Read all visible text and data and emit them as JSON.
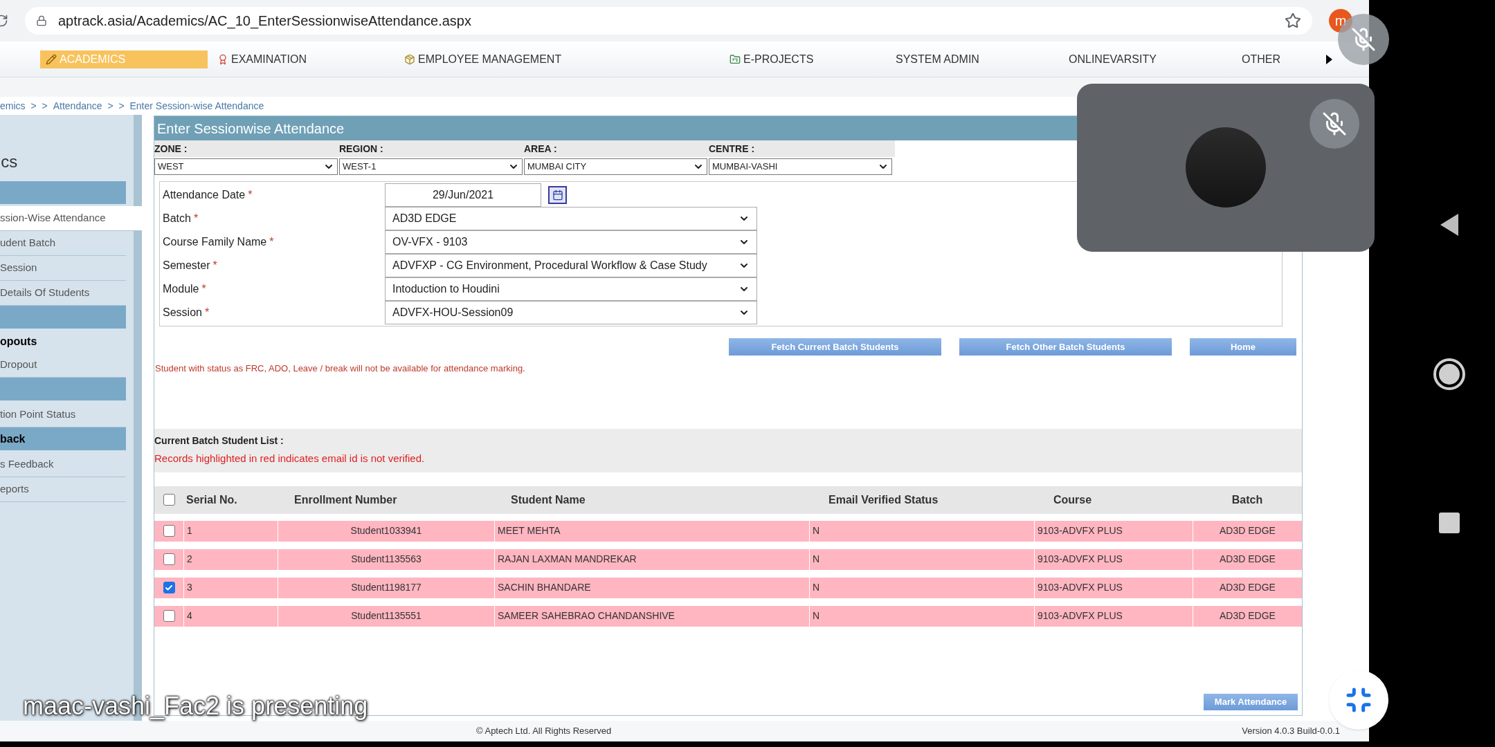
{
  "browser": {
    "url": "aptrack.asia/Academics/AC_10_EnterSessionwiseAttendance.aspx",
    "profile_initial": "m"
  },
  "menu": [
    {
      "label": "ACADEMICS",
      "selected": true,
      "kind": "pencil"
    },
    {
      "label": "EXAMINATION",
      "selected": false,
      "kind": "award"
    },
    {
      "label": "EMPLOYEE MANAGEMENT",
      "selected": false,
      "kind": "box"
    },
    {
      "label": "E-PROJECTS",
      "selected": false,
      "kind": "projects"
    },
    {
      "label": "SYSTEM ADMIN",
      "selected": false,
      "kind": "none"
    },
    {
      "label": "ONLINEVARSITY",
      "selected": false,
      "kind": "none"
    },
    {
      "label": "OTHER",
      "selected": false,
      "kind": "none"
    }
  ],
  "breadcrumb": [
    "emics",
    ">  >",
    "Attendance",
    ">  >  Enter Session-wise Attendance"
  ],
  "sidebar": {
    "title": "ics",
    "items": [
      {
        "kind": "header"
      },
      {
        "kind": "link",
        "label": "ssion-Wise Attendance",
        "selected": true
      },
      {
        "kind": "link",
        "label": "udent Batch",
        "selected": false
      },
      {
        "kind": "link",
        "label": "Session",
        "selected": false
      },
      {
        "kind": "link",
        "label": "Details Of Students",
        "selected": false
      },
      {
        "kind": "header"
      },
      {
        "kind": "section",
        "label": "opouts"
      },
      {
        "kind": "link",
        "label": "Dropout",
        "selected": false
      },
      {
        "kind": "header"
      },
      {
        "kind": "link",
        "label": "tion Point Status",
        "selected": false
      },
      {
        "kind": "header",
        "label": "back"
      },
      {
        "kind": "link",
        "label": "s Feedback",
        "selected": false
      },
      {
        "kind": "link",
        "label": "eports",
        "selected": false
      }
    ]
  },
  "panel": {
    "title": "Enter Sessionwise Attendance",
    "filters": [
      {
        "label": "ZONE :",
        "value": "WEST"
      },
      {
        "label": "REGION :",
        "value": "WEST-1"
      },
      {
        "label": "AREA :",
        "value": "MUMBAI CITY"
      },
      {
        "label": "CENTRE :",
        "value": "MUMBAI-VASHI"
      }
    ],
    "fields": [
      {
        "label": "Attendance Date",
        "mark": "*",
        "kind": "date",
        "value": "29/Jun/2021"
      },
      {
        "label": "Batch",
        "mark": "*",
        "kind": "select",
        "value": "AD3D EDGE"
      },
      {
        "label": "Course Family Name",
        "mark": "*",
        "kind": "select",
        "value": "OV-VFX - 9103"
      },
      {
        "label": "Semester",
        "mark": "*",
        "kind": "select",
        "value": "ADVFXP - CG Environment, Procedural Workflow & Case Study"
      },
      {
        "label": "Module",
        "mark": "*",
        "kind": "select",
        "value": "Intoduction to Houdini"
      },
      {
        "label": "Session",
        "mark": "*",
        "kind": "select",
        "value": "ADVFX-HOU-Session09"
      }
    ],
    "actions": [
      "Fetch Current Batch Students",
      "Fetch Other Batch Students",
      "Home"
    ],
    "note": "Student with status as FRC, ADO, Leave / break will not be available for attendance marking.",
    "list_title": "Current Batch Student List :",
    "list_note": "Records highlighted in red indicates email id is not verified.",
    "table": {
      "select_all_checked": false,
      "columns": [
        "Serial No.",
        "Enrollment Number",
        "Student Name",
        "Email Verified Status",
        "Course",
        "Batch"
      ],
      "rows": [
        {
          "checked": false,
          "highlighted": true,
          "cells": [
            "1",
            "Student1033941",
            "MEET MEHTA",
            "N",
            "9103-ADVFX PLUS",
            "AD3D EDGE"
          ]
        },
        {
          "checked": false,
          "highlighted": true,
          "cells": [
            "2",
            "Student1135563",
            "RAJAN LAXMAN MANDREKAR",
            "N",
            "9103-ADVFX PLUS",
            "AD3D EDGE"
          ]
        },
        {
          "checked": true,
          "highlighted": true,
          "cells": [
            "3",
            "Student1198177",
            "SACHIN BHANDARE",
            "N",
            "9103-ADVFX PLUS",
            "AD3D EDGE"
          ]
        },
        {
          "checked": false,
          "highlighted": true,
          "cells": [
            "4",
            "Student1135551",
            "SAMEER SAHEBRAO CHANDANSHIVE",
            "N",
            "9103-ADVFX PLUS",
            "AD3D EDGE"
          ]
        }
      ]
    },
    "submit": "Mark Attendance"
  },
  "footer": {
    "copyright": "© Aptech Ltd. All Rights Reserved",
    "version": "Version 4.0.3 Build-0.0.1"
  },
  "call": {
    "presenter": "maac-vashi_Fac2 is presenting",
    "mic_muted": true,
    "tile_mic_muted": true
  }
}
